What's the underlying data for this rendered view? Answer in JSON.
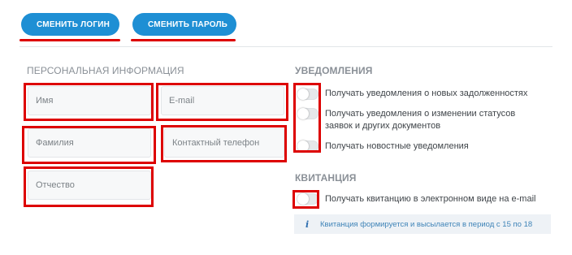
{
  "actions": {
    "change_login_label": "СМЕНИТЬ ЛОГИН",
    "change_password_label": "СМЕНИТЬ ПАРОЛЬ"
  },
  "personal_info": {
    "title": "ПЕРСОНАЛЬНАЯ ИНФОРМАЦИЯ",
    "fields": {
      "first_name": {
        "placeholder": "Имя",
        "value": ""
      },
      "email": {
        "placeholder": "E-mail",
        "value": ""
      },
      "last_name": {
        "placeholder": "Фамилия",
        "value": ""
      },
      "phone": {
        "placeholder": "Контактный телефон",
        "value": ""
      },
      "patronymic": {
        "placeholder": "Отчество",
        "value": ""
      }
    }
  },
  "notifications": {
    "title": "УВЕДОМЛЕНИЯ",
    "options": [
      {
        "label_line1": "Получать уведомления о новых задолженностях",
        "label_line2": "",
        "enabled": false
      },
      {
        "label_line1": "Получать уведомления о изменении статусов",
        "label_line2": "заявок и других документов",
        "enabled": false
      },
      {
        "label_line1": "Получать новостные уведомления",
        "label_line2": "",
        "enabled": false
      }
    ]
  },
  "receipt": {
    "title": "КВИТАНЦИЯ",
    "option": {
      "label": "Получать квитанцию в электронном виде на e-mail",
      "enabled": false
    },
    "info": "Квитанция формируется и высылается в период с 15 по 18"
  },
  "colors": {
    "accent": "#1e8fd4",
    "highlight": "#dd0000",
    "info_text": "#3f84b8"
  },
  "icons": {
    "change_login": "pencil-icon",
    "change_password": "unlock-icon",
    "info": "info-icon"
  }
}
